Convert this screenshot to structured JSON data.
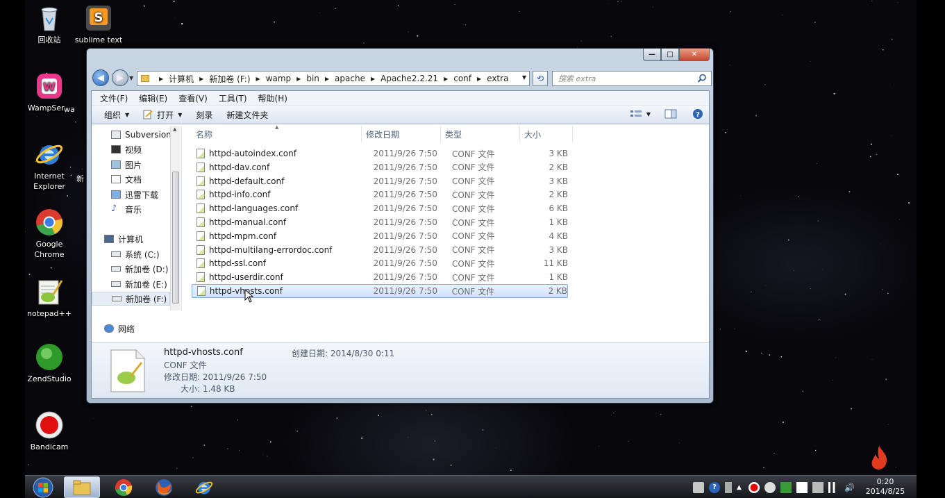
{
  "desktop": {
    "icons": [
      {
        "label": "回收站",
        "icon": "recycle-bin-icon"
      },
      {
        "label": "sublime text",
        "icon": "sublime-text-icon"
      },
      {
        "label": "WampSer...",
        "icon": "wampserver-icon"
      },
      {
        "label": "wa",
        "icon": "partial-icon"
      },
      {
        "label": "Internet Explorer",
        "icon": "internet-explorer-icon"
      },
      {
        "label": "新",
        "icon": "partial-icon"
      },
      {
        "label": "Google Chrome",
        "icon": "chrome-icon"
      },
      {
        "label": "notepad++",
        "icon": "notepad-plus-plus-icon"
      },
      {
        "label": "ZendStudio",
        "icon": "zend-studio-icon"
      },
      {
        "label": "Bandicam",
        "icon": "bandicam-icon"
      }
    ]
  },
  "window": {
    "caption_buttons": {
      "minimize": "—",
      "maximize": "□",
      "close": "✕"
    },
    "address": {
      "crumbs": [
        "计算机",
        "新加卷 (F:)",
        "wamp",
        "bin",
        "apache",
        "Apache2.2.21",
        "conf",
        "extra"
      ]
    },
    "search": {
      "placeholder": "搜索 extra"
    },
    "menu": [
      "文件(F)",
      "编辑(E)",
      "查看(V)",
      "工具(T)",
      "帮助(H)"
    ],
    "commands": {
      "organize": "组织",
      "open": "打开",
      "burn": "刻录",
      "new_folder": "新建文件夹"
    },
    "nav_pane": {
      "items": [
        "Subversion",
        "视频",
        "图片",
        "文档",
        "迅雷下载",
        "音乐",
        "计算机",
        "系统 (C:)",
        "新加卷 (D:)",
        "新加卷 (E:)",
        "新加卷 (F:)",
        "网络"
      ]
    },
    "columns": {
      "name": "名称",
      "date": "修改日期",
      "type": "类型",
      "size": "大小"
    },
    "files": [
      {
        "name": "httpd-autoindex.conf",
        "date": "2011/9/26 7:50",
        "type": "CONF 文件",
        "size": "3 KB"
      },
      {
        "name": "httpd-dav.conf",
        "date": "2011/9/26 7:50",
        "type": "CONF 文件",
        "size": "2 KB"
      },
      {
        "name": "httpd-default.conf",
        "date": "2011/9/26 7:50",
        "type": "CONF 文件",
        "size": "3 KB"
      },
      {
        "name": "httpd-info.conf",
        "date": "2011/9/26 7:50",
        "type": "CONF 文件",
        "size": "2 KB"
      },
      {
        "name": "httpd-languages.conf",
        "date": "2011/9/26 7:50",
        "type": "CONF 文件",
        "size": "6 KB"
      },
      {
        "name": "httpd-manual.conf",
        "date": "2011/9/26 7:50",
        "type": "CONF 文件",
        "size": "1 KB"
      },
      {
        "name": "httpd-mpm.conf",
        "date": "2011/9/26 7:50",
        "type": "CONF 文件",
        "size": "4 KB"
      },
      {
        "name": "httpd-multilang-errordoc.conf",
        "date": "2011/9/26 7:50",
        "type": "CONF 文件",
        "size": "3 KB"
      },
      {
        "name": "httpd-ssl.conf",
        "date": "2011/9/26 7:50",
        "type": "CONF 文件",
        "size": "11 KB"
      },
      {
        "name": "httpd-userdir.conf",
        "date": "2011/9/26 7:50",
        "type": "CONF 文件",
        "size": "1 KB"
      },
      {
        "name": "httpd-vhosts.conf",
        "date": "2011/9/26 7:50",
        "type": "CONF 文件",
        "size": "2 KB"
      }
    ],
    "selected_index": 10,
    "details": {
      "filename": "httpd-vhosts.conf",
      "type": "CONF 文件",
      "modified": "修改日期: 2011/9/26 7:50",
      "size": "大小: 1.48 KB",
      "created": "创建日期: 2014/8/30 0:11"
    }
  },
  "taskbar": {
    "clock_time": "0:20",
    "clock_date": "2014/8/25"
  },
  "colors": {
    "selection": "#cfe2f8",
    "accent": "#2a63b8"
  }
}
